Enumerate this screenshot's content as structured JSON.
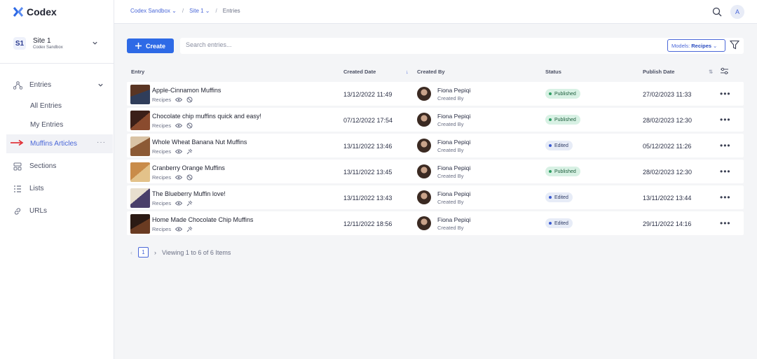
{
  "app": {
    "name": "Codex"
  },
  "topbar": {
    "breadcrumbs": [
      "Codex Sandbox",
      "Site 1",
      "Entries"
    ],
    "avatar_initial": "A"
  },
  "site": {
    "badge": "S1",
    "name": "Site 1",
    "sub": "Codex Sandbox"
  },
  "sidebar": {
    "items": [
      {
        "label": "Entries",
        "icon": "entries-icon"
      },
      {
        "label": "All Entries"
      },
      {
        "label": "My Entries"
      },
      {
        "label": "Muffins Articles",
        "active": true
      },
      {
        "label": "Sections",
        "icon": "sections-icon"
      },
      {
        "label": "Lists",
        "icon": "lists-icon"
      },
      {
        "label": "URLs",
        "icon": "link-icon"
      }
    ]
  },
  "toolbar": {
    "create_label": "Create",
    "search_placeholder": "Search entries...",
    "models_label": "Models:",
    "models_value": "Recipes"
  },
  "table": {
    "columns": [
      "Entry",
      "Created Date",
      "Created By",
      "Status",
      "Publish Date"
    ],
    "rows": [
      {
        "title": "Apple-Cinnamon Muffins",
        "model": "Recipes",
        "created": "13/12/2022 11:49",
        "user": "Fiona Pepiqi",
        "role": "Created By",
        "status": "Published",
        "published": "27/02/2023 11:33"
      },
      {
        "title": "Chocolate chip muffins quick and easy!",
        "model": "Recipes",
        "created": "07/12/2022 17:54",
        "user": "Fiona Pepiqi",
        "role": "Created By",
        "status": "Published",
        "published": "28/02/2023 12:30"
      },
      {
        "title": "Whole Wheat Banana Nut Muffins",
        "model": "Recipes",
        "created": "13/11/2022 13:46",
        "user": "Fiona Pepiqi",
        "role": "Created By",
        "status": "Edited",
        "published": "05/12/2022 11:26"
      },
      {
        "title": "Cranberry Orange Muffins",
        "model": "Recipes",
        "created": "13/11/2022 13:45",
        "user": "Fiona Pepiqi",
        "role": "Created By",
        "status": "Published",
        "published": "28/02/2023 12:30"
      },
      {
        "title": "The Blueberry Muffin love!",
        "model": "Recipes",
        "created": "13/11/2022 13:43",
        "user": "Fiona Pepiqi",
        "role": "Created By",
        "status": "Edited",
        "published": "13/11/2022 13:44"
      },
      {
        "title": "Home Made Chocolate Chip Muffins",
        "model": "Recipes",
        "created": "12/11/2022 18:56",
        "user": "Fiona Pepiqi",
        "role": "Created By",
        "status": "Edited",
        "published": "29/11/2022 14:16"
      }
    ]
  },
  "pagination": {
    "page": "1",
    "info": "Viewing 1 to 6 of 6 Items"
  },
  "colors": {
    "accent": "#2e6ae6",
    "published_bg": "#d8f1e4",
    "edited_bg": "#e7ecf7"
  }
}
